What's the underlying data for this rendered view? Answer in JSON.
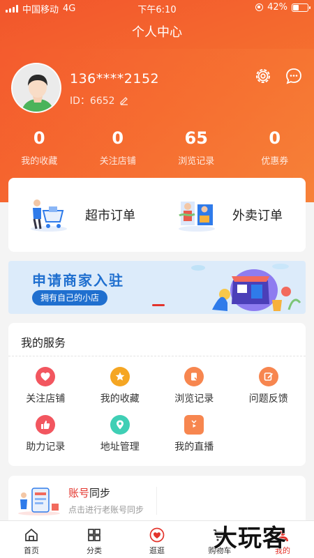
{
  "status": {
    "carrier": "中国移动",
    "network": "4G",
    "time": "下午6:10",
    "battery_text": "42%",
    "battery_level": 0.42
  },
  "header": {
    "title": "个人中心"
  },
  "profile": {
    "phone": "136****2152",
    "id_label": "ID：6652"
  },
  "stats": [
    {
      "value": "0",
      "label": "我的收藏"
    },
    {
      "value": "0",
      "label": "关注店铺"
    },
    {
      "value": "65",
      "label": "浏览记录"
    },
    {
      "value": "0",
      "label": "优惠券"
    }
  ],
  "orders": [
    {
      "label": "超市订单",
      "icon": "supermarket-cart-icon"
    },
    {
      "label": "外卖订单",
      "icon": "takeaway-delivery-icon"
    }
  ],
  "banner": {
    "title": "申请商家入驻",
    "subtitle": "拥有自己的小店"
  },
  "services": {
    "title": "我的服务",
    "items": [
      {
        "label": "关注店铺",
        "icon": "heart-icon",
        "color": "#f2565f"
      },
      {
        "label": "我的收藏",
        "icon": "star-icon",
        "color": "#f5a623"
      },
      {
        "label": "浏览记录",
        "icon": "history-icon",
        "color": "#f7864f"
      },
      {
        "label": "问题反馈",
        "icon": "feedback-icon",
        "color": "#f7864f"
      },
      {
        "label": "助力记录",
        "icon": "thumb-up-icon",
        "color": "#f2565f"
      },
      {
        "label": "地址管理",
        "icon": "location-pin-icon",
        "color": "#3fcfb5"
      },
      {
        "label": "我的直播",
        "icon": "live-tv-icon",
        "color": "#f7864f"
      }
    ]
  },
  "sync": {
    "title_highlight": "账号",
    "title_rest": "同步",
    "subtitle": "点击进行老账号同步"
  },
  "tabs": [
    {
      "label": "首页",
      "icon": "home-icon"
    },
    {
      "label": "分类",
      "icon": "category-grid-icon"
    },
    {
      "label": "逛逛",
      "icon": "heart-badge-icon"
    },
    {
      "label": "购物车",
      "icon": "cart-icon"
    },
    {
      "label": "我的",
      "icon": "profile-icon"
    }
  ],
  "watermark": "大玩客",
  "colors": {
    "primary": "#f2552c",
    "accent_red": "#e3332b",
    "banner_blue": "#1f6fcf"
  }
}
